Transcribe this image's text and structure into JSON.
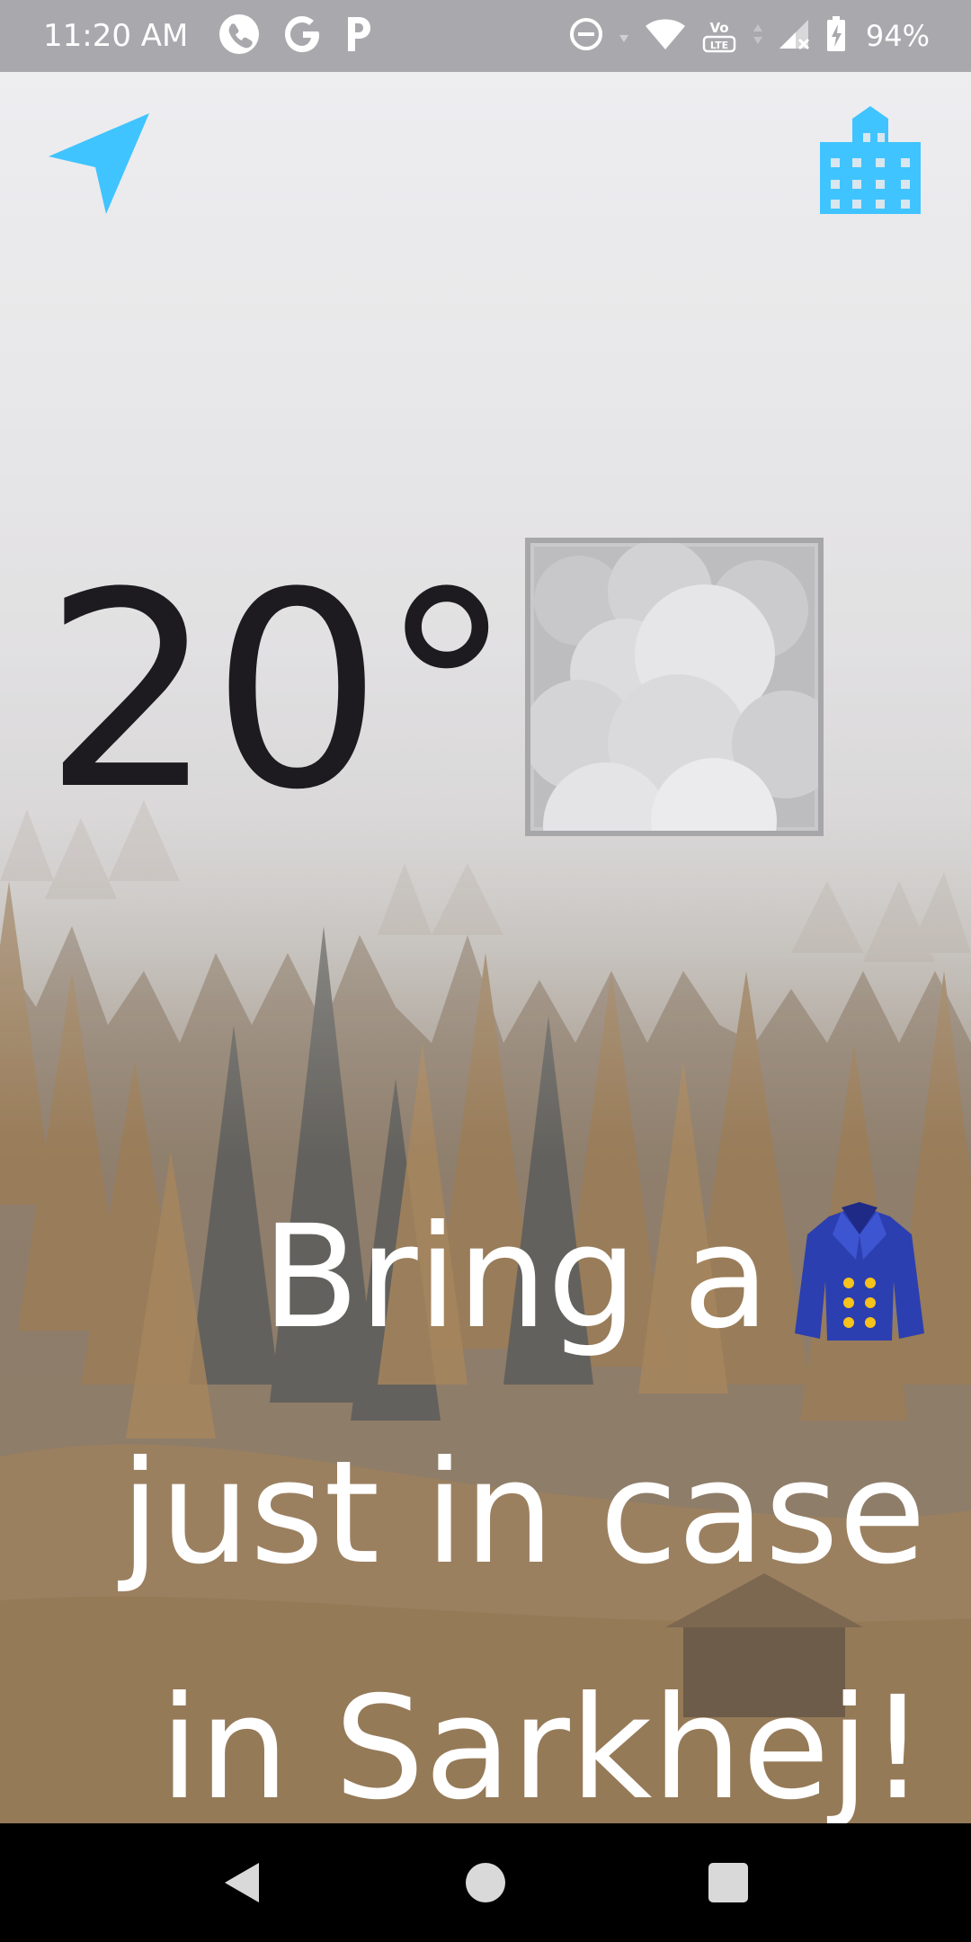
{
  "status_bar": {
    "time": "11:20 AM",
    "battery": "94%",
    "left_icons": [
      "phone-icon",
      "google-icon",
      "p-icon"
    ],
    "right_icons": [
      "dnd-icon",
      "wifi-icon",
      "volte-icon",
      "signal-icon",
      "battery-icon"
    ]
  },
  "weather": {
    "temperature": "20°",
    "condition_icon": "fog-cloud-icon"
  },
  "message": {
    "line1": "Bring a",
    "line2": "just in case",
    "line3": "in Sarkhej!",
    "emoji": "coat-icon"
  },
  "colors": {
    "accent": "#40c4ff",
    "temperature_text": "#1d1b20",
    "message_text": "#ffffff",
    "status_bar": "#a9a9ad"
  },
  "nav_bar": {
    "buttons": [
      "back-icon",
      "home-icon",
      "recents-icon"
    ]
  }
}
